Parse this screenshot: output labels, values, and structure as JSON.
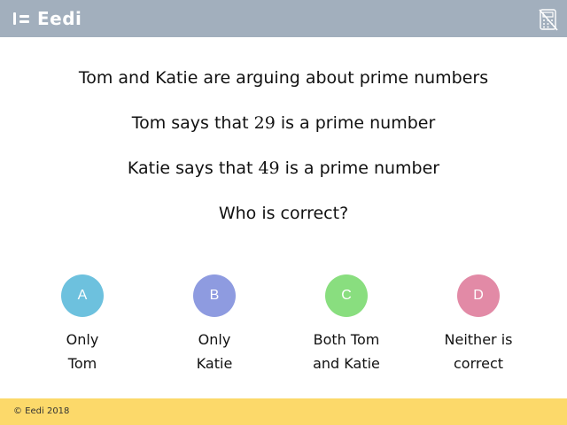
{
  "header": {
    "brand": "Eedi",
    "logo_icon": "eedi-logo-icon",
    "calculator_icon": "no-calculator-icon"
  },
  "question": {
    "line1": "Tom and Katie are arguing about prime numbers",
    "line2_prefix": "Tom says that ",
    "line2_number": "29",
    "line2_suffix": " is a prime number",
    "line3_prefix": "Katie says that ",
    "line3_number": "49",
    "line3_suffix": " is a prime number",
    "line4": "Who is correct?"
  },
  "options": [
    {
      "letter": "A",
      "line1": "Only",
      "line2": "Tom",
      "color": "#6dc1de"
    },
    {
      "letter": "B",
      "line1": "Only",
      "line2": "Katie",
      "color": "#8e9be0"
    },
    {
      "letter": "C",
      "line1": "Both Tom",
      "line2": "and Katie",
      "color": "#89de7f"
    },
    {
      "letter": "D",
      "line1": "Neither is",
      "line2": "correct",
      "color": "#e28aa6"
    }
  ],
  "footer": {
    "copyright": "© Eedi 2018"
  },
  "colors": {
    "header_bg": "#a2afbd",
    "footer_bg": "#fcd96a"
  }
}
